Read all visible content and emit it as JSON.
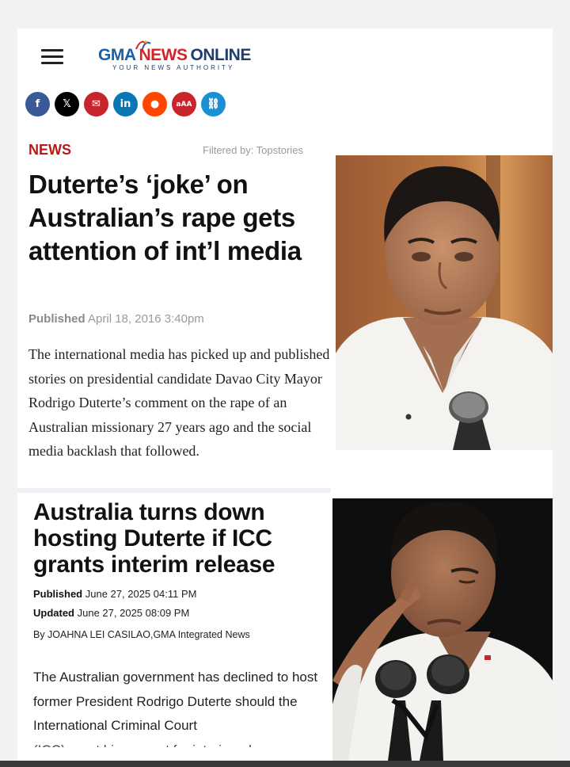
{
  "header": {
    "logo_gma": "GMA",
    "logo_news": "NEWS",
    "logo_online": "ONLINE",
    "logo_tagline": "YOUR NEWS AUTHORITY",
    "menu_icon": "hamburger-menu-icon"
  },
  "share": [
    {
      "name": "facebook-share-icon",
      "glyph": "f",
      "color": "#3b5998"
    },
    {
      "name": "x-share-icon",
      "glyph": "𝕏",
      "color": "#000000"
    },
    {
      "name": "email-share-icon",
      "glyph": "✉",
      "color": "#c8242b"
    },
    {
      "name": "linkedin-share-icon",
      "glyph": "in",
      "color": "#0a77b5"
    },
    {
      "name": "reddit-share-icon",
      "glyph": "●",
      "color": "#ff4500"
    },
    {
      "name": "font-size-icon",
      "glyph": "aAA",
      "color": "#c8242b"
    },
    {
      "name": "link-share-icon",
      "glyph": "⛓",
      "color": "#1a8fd6"
    }
  ],
  "article1": {
    "section": "NEWS",
    "filtered": "Filtered by: Topstories",
    "headline": "Duterte’s ‘joke’ on Australian’s rape gets attention of int’l media",
    "published_label": "Published",
    "published_date": "April 18, 2016 3:40pm",
    "body": "The international media has picked up and published stories on presidential candidate Davao City Mayor Rodrigo Duterte’s comment on the rape of an Australian missionary 27 years ago and the social media backlash that followed."
  },
  "article2": {
    "headline": "Australia turns down hosting Duterte if ICC grants interim release",
    "published_label": "Published",
    "published_date": "June 27, 2025 04:11 PM",
    "updated_label": "Updated",
    "updated_date": "June 27, 2025 08:09 PM",
    "byline": "By JOAHNA LEI CASILAO,GMA Integrated News",
    "body": "The Australian government has declined to host former President Rodrigo Duterte should the International Criminal Court",
    "body_cut": "(ICC) grant his request for interim release"
  }
}
